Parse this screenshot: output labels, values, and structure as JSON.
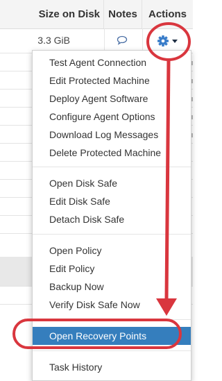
{
  "table": {
    "header": {
      "size_on_disk": "Size on Disk",
      "notes": "Notes",
      "actions": "Actions"
    },
    "first_row": {
      "size": "3.3 GiB"
    }
  },
  "menu": {
    "groups": [
      [
        "Test Agent Connection",
        "Edit Protected Machine",
        "Deploy Agent Software",
        "Configure Agent Options",
        "Download Log Messages",
        "Delete Protected Machine"
      ],
      [
        "Open Disk Safe",
        "Edit Disk Safe",
        "Detach Disk Safe"
      ],
      [
        "Open Policy",
        "Edit Policy",
        "Backup Now",
        "Verify Disk Safe Now"
      ],
      [
        "Open Recovery Points"
      ],
      [
        "Task History"
      ]
    ],
    "highlighted": "Open Recovery Points"
  },
  "colors": {
    "accent": "#357ebd",
    "annotation": "#d9363e",
    "gear": "#3a7dc9"
  }
}
